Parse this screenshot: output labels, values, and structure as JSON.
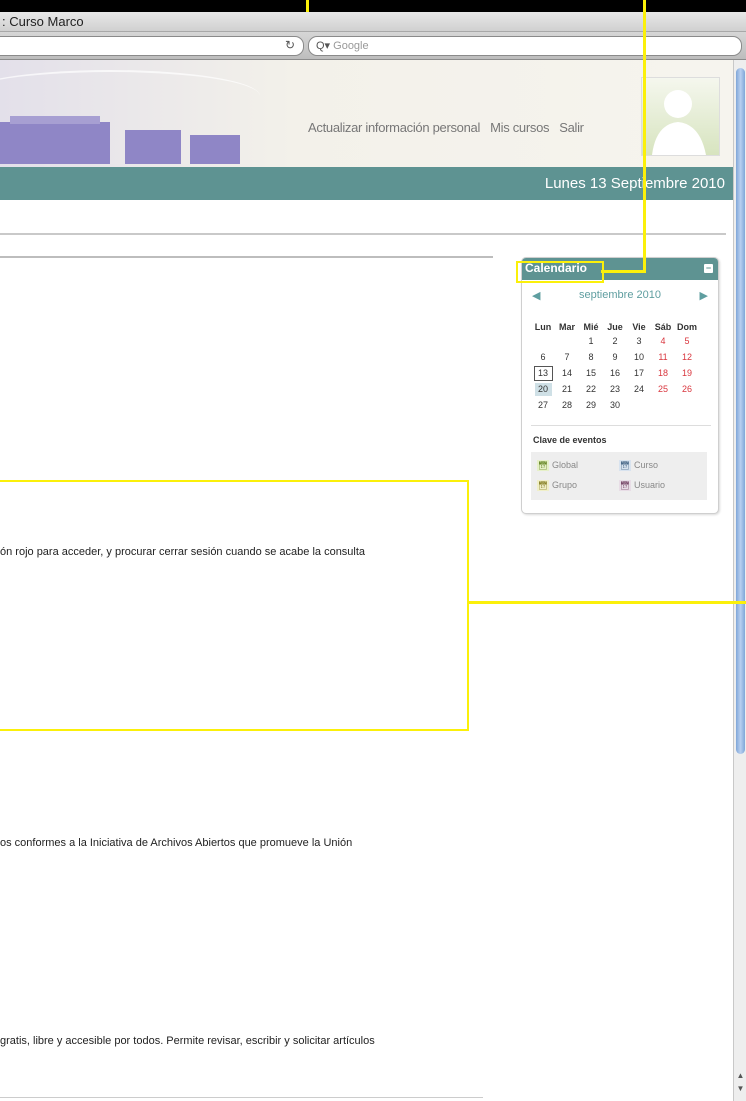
{
  "window": {
    "title_fragment": ": Curso Marco"
  },
  "toolbar": {
    "search_placeholder": "Google",
    "reload_icon": "reload-icon",
    "search_icon": "magnifier-icon"
  },
  "header": {
    "links": [
      "Actualizar información personal",
      "Mis cursos",
      "Salir"
    ],
    "date": "Lunes 13 Septiembre 2010"
  },
  "calendar": {
    "title": "Calendario",
    "month": "septiembre 2010",
    "weekdays": [
      "Lun",
      "Mar",
      "Mié",
      "Jue",
      "Vie",
      "Sáb",
      "Dom"
    ],
    "weeks": [
      [
        "",
        "",
        "1",
        "2",
        "3",
        "4",
        "5"
      ],
      [
        "6",
        "7",
        "8",
        "9",
        "10",
        "11",
        "12"
      ],
      [
        "13",
        "14",
        "15",
        "16",
        "17",
        "18",
        "19"
      ],
      [
        "20",
        "21",
        "22",
        "23",
        "24",
        "25",
        "26"
      ],
      [
        "27",
        "28",
        "29",
        "30",
        "",
        "",
        ""
      ]
    ],
    "today": "13",
    "selected": "20",
    "key_title": "Clave de eventos",
    "keys": [
      "Global",
      "Curso",
      "Grupo",
      "Usuario"
    ],
    "weekend_color": "#d9363e",
    "accent_color": "#5e9392"
  },
  "content": {
    "line1": "ón rojo para acceder, y procurar cerrar sesión cuando se acabe la consulta",
    "line2": "os conformes a la Iniciativa de Archivos Abiertos que promueve la Unión",
    "line3": "gratis, libre y accesible por todos. Permite revisar, escribir y solicitar artículos"
  },
  "annotation_color": "#fbf00a"
}
